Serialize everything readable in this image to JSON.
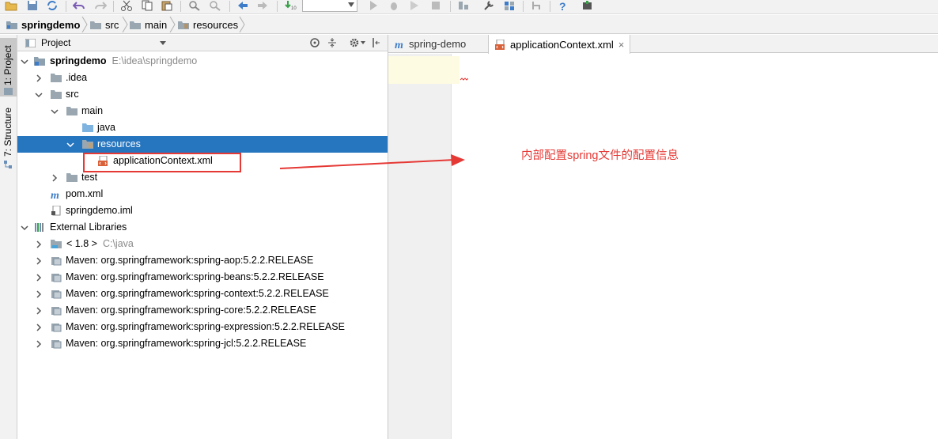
{
  "breadcrumb": {
    "items": [
      "springdemo",
      "src",
      "main",
      "resources"
    ]
  },
  "tool_stripe": {
    "project_tab": "1: Project",
    "structure_tab": "7: Structure"
  },
  "project_panel": {
    "title": "Project",
    "tree": [
      {
        "label": "springdemo",
        "path": "E:\\idea\\springdemo",
        "bold": true
      },
      {
        "label": ".idea"
      },
      {
        "label": "src"
      },
      {
        "label": "main"
      },
      {
        "label": "java"
      },
      {
        "label": "resources",
        "selected": true
      },
      {
        "label": "applicationContext.xml"
      },
      {
        "label": "test"
      },
      {
        "label": "pom.xml"
      },
      {
        "label": "springdemo.iml"
      },
      {
        "label": "External Libraries"
      },
      {
        "label": "< 1.8 >",
        "path": "C:\\java"
      },
      {
        "label": "Maven: org.springframework:spring-aop:5.2.2.RELEASE"
      },
      {
        "label": "Maven: org.springframework:spring-beans:5.2.2.RELEASE"
      },
      {
        "label": "Maven: org.springframework:spring-context:5.2.2.RELEASE"
      },
      {
        "label": "Maven: org.springframework:spring-core:5.2.2.RELEASE"
      },
      {
        "label": "Maven: org.springframework:spring-expression:5.2.2.RELEASE"
      },
      {
        "label": "Maven: org.springframework:spring-jcl:5.2.2.RELEASE"
      }
    ]
  },
  "editor": {
    "tabs": [
      {
        "label": "spring-demo",
        "active": false
      },
      {
        "label": "applicationContext.xml",
        "active": true,
        "close": "×"
      }
    ]
  },
  "annotation": {
    "text": "内部配置spring文件的配置信息",
    "color": "#e53935"
  },
  "colors": {
    "selection": "#2675bf",
    "folder": "#9aa7b0",
    "source_folder": "#7fb4e0"
  }
}
